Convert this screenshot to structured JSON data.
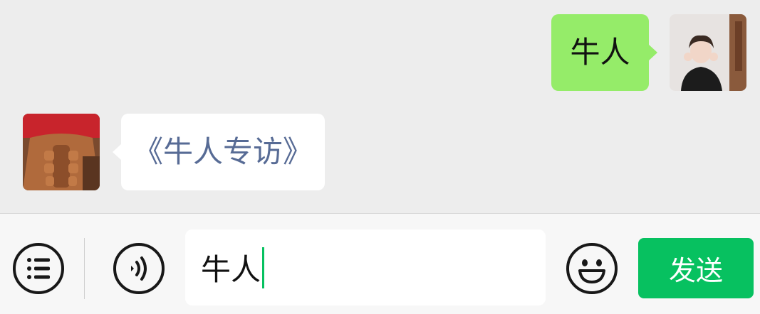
{
  "messages": [
    {
      "sender": "self",
      "text": "牛人",
      "avatar": "self-avatar-photo"
    },
    {
      "sender": "other",
      "text": "《牛人专访》",
      "avatar": "other-avatar-photo",
      "is_link": true
    }
  ],
  "input_bar": {
    "menu_icon": "list-icon",
    "voice_icon": "voice-icon",
    "input_value": "牛人",
    "emoji_icon": "smiley-icon",
    "send_label": "发送"
  },
  "colors": {
    "background": "#ededed",
    "self_bubble": "#95ec69",
    "other_bubble": "#ffffff",
    "link_text": "#576b95",
    "accent_green": "#07c160",
    "input_bar": "#f7f7f7"
  }
}
